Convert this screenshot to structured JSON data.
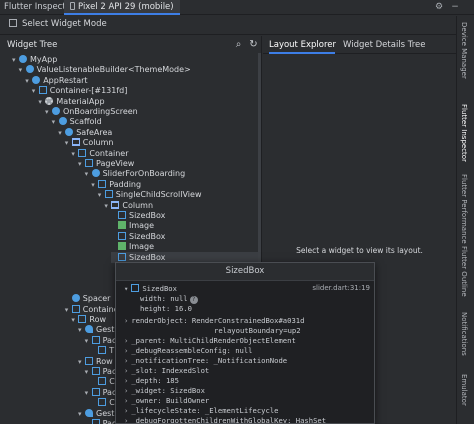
{
  "window": {
    "title": "Flutter Inspector",
    "device_tab": "Pixel 2 API 29 (mobile)"
  },
  "toolbar": {
    "select_widget_mode": "Select Widget Mode"
  },
  "widget_tree": {
    "title": "Widget Tree",
    "nodes": [
      {
        "label": "MyApp",
        "icon": "circle"
      },
      {
        "label": "ValueListenableBuilder<ThemeMode>",
        "icon": "circle"
      },
      {
        "label": "AppRestart",
        "icon": "circle"
      },
      {
        "label": "Container-[#131fd]",
        "icon": "square"
      },
      {
        "label": "MaterialApp",
        "icon": "gear"
      },
      {
        "label": "OnBoardingScreen",
        "icon": "circle"
      },
      {
        "label": "Scaffold",
        "icon": "circle"
      },
      {
        "label": "SafeArea",
        "icon": "circle"
      },
      {
        "label": "Column",
        "icon": "column"
      },
      {
        "label": "Container",
        "icon": "square"
      },
      {
        "label": "PageView",
        "icon": "square"
      },
      {
        "label": "SliderForOnBoarding",
        "icon": "circle"
      },
      {
        "label": "Padding",
        "icon": "square"
      },
      {
        "label": "SingleChildScrollView",
        "icon": "scroll"
      },
      {
        "label": "Column",
        "icon": "column"
      },
      {
        "label": "SizedBox",
        "icon": "square"
      },
      {
        "label": "Image",
        "icon": "image"
      },
      {
        "label": "SizedBox",
        "icon": "square"
      },
      {
        "label": "Image",
        "icon": "image"
      },
      {
        "label": "SizedBox",
        "icon": "square"
      },
      {
        "label": "",
        "icon": ""
      },
      {
        "label": "",
        "icon": ""
      },
      {
        "label": "",
        "icon": ""
      },
      {
        "label": "Spacer",
        "icon": "circle"
      },
      {
        "label": "Container",
        "icon": "square"
      },
      {
        "label": "Row",
        "icon": "square"
      },
      {
        "label": "Gestu",
        "icon": "gesture"
      },
      {
        "label": "Pac",
        "icon": "square"
      },
      {
        "label": "T",
        "icon": "square"
      },
      {
        "label": "Row",
        "icon": "square"
      },
      {
        "label": "Pac",
        "icon": "square"
      },
      {
        "label": "C",
        "icon": "square"
      },
      {
        "label": "Pac",
        "icon": "square"
      },
      {
        "label": "C",
        "icon": "square"
      },
      {
        "label": "Gestu",
        "icon": "gesture"
      },
      {
        "label": "Padding",
        "icon": "square"
      }
    ]
  },
  "details": {
    "tabs": [
      "Layout Explorer",
      "Widget Details Tree"
    ],
    "placeholder": "Select a widget to view its layout."
  },
  "popup": {
    "title": "SizedBox",
    "widget": "SizedBox",
    "source": "slider.dart:31:19",
    "width_line": "width: null",
    "height_line": "height: 16.0",
    "properties": [
      {
        "key": "renderObject:",
        "value": "RenderConstrainedBox#a031d",
        "extra": "relayoutBoundary=up2"
      },
      {
        "key": "_parent:",
        "value": "MultiChildRenderObjectElement"
      },
      {
        "key": "_debugReassembleConfig:",
        "value": "null"
      },
      {
        "key": "_notificationTree:",
        "value": "_NotificationNode"
      },
      {
        "key": "_slot:",
        "value": "IndexedSlot"
      },
      {
        "key": "_depth:",
        "value": "185"
      },
      {
        "key": "_widget:",
        "value": "SizedBox"
      },
      {
        "key": "_owner:",
        "value": "BuildOwner"
      },
      {
        "key": "_lifecycleState:",
        "value": "_ElementLifecycle"
      },
      {
        "key": "_debugForgottenChildrenWithGlobalKey:",
        "value": "HashSet"
      }
    ]
  },
  "side_tabs": [
    "Device Manager",
    "Flutter Inspector",
    "Flutter Performance",
    "Flutter Outline",
    "Notifications",
    "Emulator"
  ],
  "colors": {
    "accent": "#3d7ee6",
    "background": "#2b2d30",
    "widget_icon": "#4d9de0",
    "image_icon": "#5fb36a"
  }
}
